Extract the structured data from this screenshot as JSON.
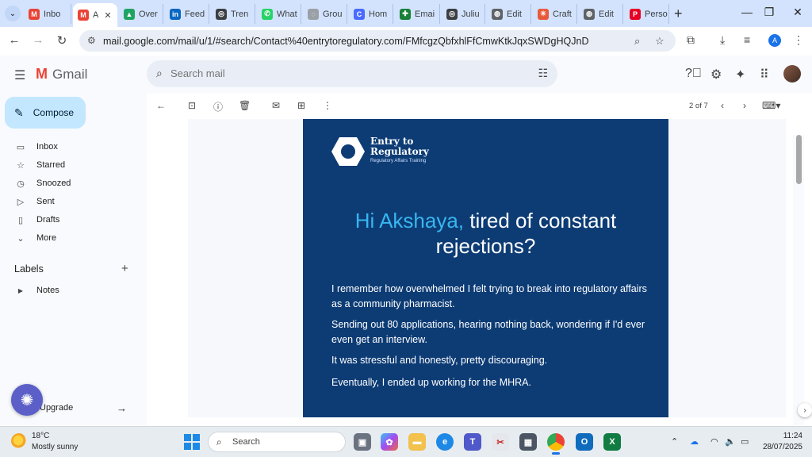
{
  "browser": {
    "tabs": [
      {
        "label": "Inbo",
        "icon": "gmail-icon",
        "color": "#ea4335",
        "glyph": "M"
      },
      {
        "label": "A",
        "icon": "gmail-icon",
        "color": "#ea4335",
        "glyph": "M"
      },
      {
        "label": "Over",
        "icon": "google-drive-icon",
        "color": "#1fa463",
        "glyph": "▲"
      },
      {
        "label": "Feed",
        "icon": "linkedin-icon",
        "color": "#0a66c2",
        "glyph": "in"
      },
      {
        "label": "Tren",
        "icon": "chatgpt-icon",
        "color": "#3c4043",
        "glyph": "◎"
      },
      {
        "label": "What",
        "icon": "whatsapp-icon",
        "color": "#25d366",
        "glyph": "✆"
      },
      {
        "label": "Grou",
        "icon": "groups-icon",
        "color": "#9aa0a6",
        "glyph": "◌"
      },
      {
        "label": "Hom",
        "icon": "canva-icon",
        "color": "#4b6bff",
        "glyph": "C"
      },
      {
        "label": "Emai",
        "icon": "sheets-icon",
        "color": "#188038",
        "glyph": "✚"
      },
      {
        "label": "Juliu",
        "icon": "chatgpt-icon",
        "color": "#3c4043",
        "glyph": "◎"
      },
      {
        "label": "Edit",
        "icon": "globe-icon",
        "color": "#5f6368",
        "glyph": "◍"
      },
      {
        "label": "Craft",
        "icon": "craft-icon",
        "color": "#e8593a",
        "glyph": "✳"
      },
      {
        "label": "Edit",
        "icon": "globe-icon",
        "color": "#5f6368",
        "glyph": "◍"
      },
      {
        "label": "Perso",
        "icon": "pinterest-icon",
        "color": "#e60023",
        "glyph": "P"
      }
    ],
    "url": "mail.google.com/mail/u/1/#search/Contact%40entrytoregulatory.com/FMfcgzQbfxhlFfCmwKtkJqxSWDgHQJnD",
    "profile_initial": "A"
  },
  "gmail": {
    "logo_text": "Gmail",
    "search_placeholder": "Search mail",
    "compose_label": "Compose",
    "nav": [
      {
        "label": "Inbox",
        "icon": "inbox-icon",
        "glyph": "▭"
      },
      {
        "label": "Starred",
        "icon": "star-icon",
        "glyph": "☆"
      },
      {
        "label": "Snoozed",
        "icon": "clock-icon",
        "glyph": "◷"
      },
      {
        "label": "Sent",
        "icon": "send-icon",
        "glyph": "▷"
      },
      {
        "label": "Drafts",
        "icon": "draft-icon",
        "glyph": "▯"
      },
      {
        "label": "More",
        "icon": "chevron-down-icon",
        "glyph": "⌄"
      }
    ],
    "labels_header": "Labels",
    "labels": [
      {
        "label": "Notes",
        "icon": "label-icon",
        "glyph": "▶"
      }
    ],
    "upgrade_label": "Upgrade",
    "pager": "2 of 7"
  },
  "email": {
    "brand_line1": "Entry to",
    "brand_line2": "Regulatory",
    "brand_sub": "Regulatory Affairs Training",
    "headline_name": "Hi Akshaya,",
    "headline_rest": " tired of constant rejections?",
    "paragraphs": [
      "I remember how overwhelmed I felt trying to break into regulatory affairs as a community pharmacist.",
      "Sending out 80 applications, hearing nothing back, wondering if I'd ever even get an interview.",
      "It was stressful and honestly, pretty discouraging.",
      "Eventually, I ended up working for the MHRA."
    ],
    "colors": {
      "card_bg": "#0d3c75",
      "accent": "#38b6f0"
    }
  },
  "taskbar": {
    "weather_temp": "18°C",
    "weather_desc": "Mostly sunny",
    "search_placeholder": "Search",
    "time": "11:24",
    "date": "28/07/2025"
  }
}
